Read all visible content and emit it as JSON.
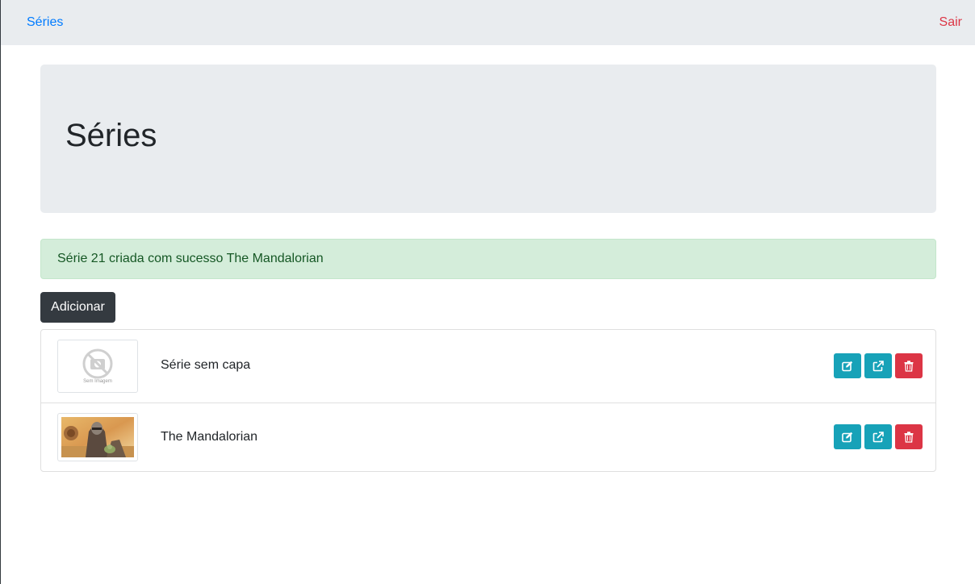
{
  "nav": {
    "brand": "Séries",
    "logout": "Sair"
  },
  "header": {
    "title": "Séries"
  },
  "alert": {
    "message": "Série 21 criada com sucesso The Mandalorian"
  },
  "toolbar": {
    "add_label": "Adicionar"
  },
  "series": [
    {
      "title": "Série sem capa",
      "thumbnail_text": "Sem Imagem",
      "thumbnail": "no-image-icon"
    },
    {
      "title": "The Mandalorian",
      "thumbnail": "series-cover-image"
    }
  ],
  "colors": {
    "primary": "#007bff",
    "danger": "#dc3545",
    "info": "#17a2b8",
    "dark": "#343a40",
    "success_bg": "#d4edda",
    "success_text": "#155724"
  },
  "icons": {
    "edit": "edit-icon",
    "open": "external-link-icon",
    "delete": "trash-icon"
  }
}
